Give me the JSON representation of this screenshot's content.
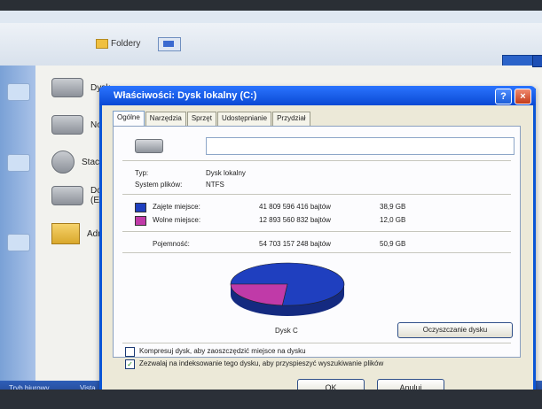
{
  "explorer": {
    "toolbar_folders_label": "Foldery",
    "drives": [
      {
        "label": "Dysk"
      },
      {
        "label": "Nov"
      },
      {
        "label": "Stac"
      },
      {
        "label": "Dołą",
        "sub": "(E"
      },
      {
        "label": "Adm"
      }
    ]
  },
  "taskbar": {
    "items": [
      "Tryb biurowy",
      "Vista"
    ]
  },
  "dialog": {
    "title": "Właściwości: Dysk lokalny (C:)",
    "title_buttons": {
      "help": "?",
      "close": "×"
    },
    "tabs": [
      {
        "label": "Ogólne",
        "active": true
      },
      {
        "label": "Narzędzia"
      },
      {
        "label": "Sprzęt"
      },
      {
        "label": "Udostępnianie"
      },
      {
        "label": "Przydział"
      }
    ],
    "name_value": "",
    "type_label": "Typ:",
    "type_value": "Dysk lokalny",
    "fs_label": "System plików:",
    "fs_value": "NTFS",
    "used_label": "Zajęte miejsce:",
    "used_bytes": "41 809 596 416 bajtów",
    "used_gb": "38,9 GB",
    "free_label": "Wolne miejsce:",
    "free_bytes": "12 893 560 832 bajtów",
    "free_gb": "12,0 GB",
    "capacity_label": "Pojemność:",
    "capacity_bytes": "54 703 157 248 bajtów",
    "capacity_gb": "50,9 GB",
    "pie_label": "Dysk C",
    "cleanup_button": "Oczyszczanie dysku",
    "compress_label": "Kompresuj dysk, aby zaoszczędzić miejsce na dysku",
    "compress_checked": false,
    "index_label": "Zezwalaj na indeksowanie tego dysku, aby przyspieszyć wyszukiwanie plików",
    "index_checked": true,
    "ok_button": "OK",
    "cancel_button": "Anuluj"
  },
  "colors": {
    "used": "#1f3fbf",
    "free": "#c03aa8"
  },
  "chart_data": {
    "type": "pie",
    "categories": [
      "Zajęte miejsce",
      "Wolne miejsce"
    ],
    "values": [
      38.9,
      12.0
    ],
    "unit": "GB",
    "title": "Dysk C"
  }
}
